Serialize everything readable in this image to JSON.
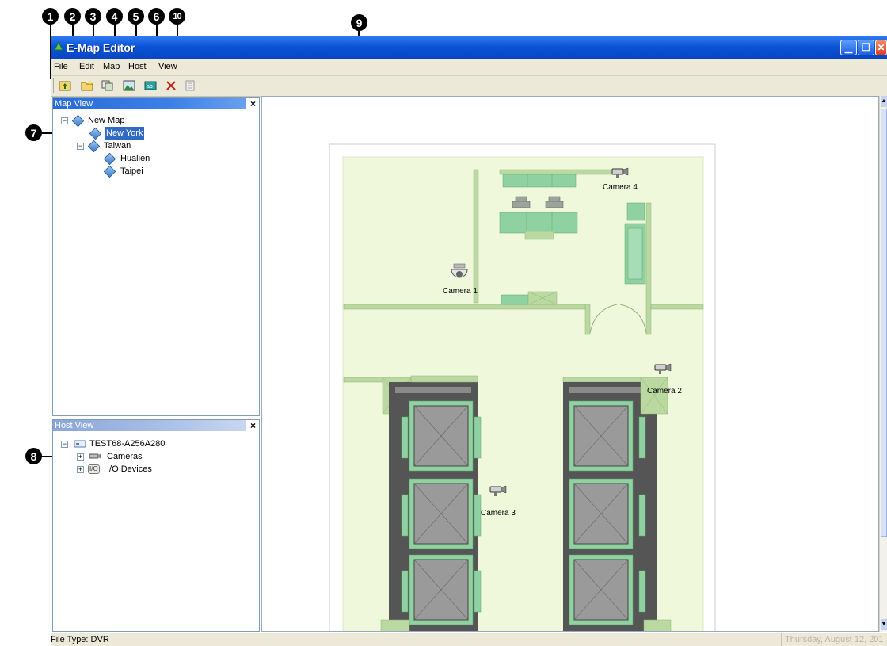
{
  "window": {
    "title": "E-Map Editor"
  },
  "menu": [
    "File",
    "Edit",
    "Map",
    "Host",
    "View"
  ],
  "callouts": [
    "1",
    "2",
    "3",
    "4",
    "5",
    "6",
    "10",
    "7",
    "8",
    "9"
  ],
  "map_view": {
    "header": "Map View",
    "close": "×",
    "tree": [
      {
        "label": "New Map",
        "expander": "−"
      },
      {
        "label": "New York",
        "selected": true
      },
      {
        "label": "Taiwan",
        "expander": "−"
      },
      {
        "label": "Hualien"
      },
      {
        "label": "Taipei"
      }
    ]
  },
  "host_view": {
    "header": "Host View",
    "close": "×",
    "tree": [
      {
        "label": "TEST68-A256A280",
        "expander": "−"
      },
      {
        "label": "Cameras",
        "expander": "+"
      },
      {
        "label": "I/O Devices",
        "expander": "+",
        "badge": "I/O"
      }
    ]
  },
  "map": {
    "cameras": [
      "Camera 1",
      "Camera 2",
      "Camera 3",
      "Camera 4"
    ]
  },
  "status": {
    "left": "File Type: DVR",
    "right": "Thursday, August 12, 201"
  },
  "colors": {
    "floor": "#f0f8dc",
    "furniture": "#8fd1a1",
    "wall": "#b9d9a0",
    "elevator": "#555555"
  }
}
